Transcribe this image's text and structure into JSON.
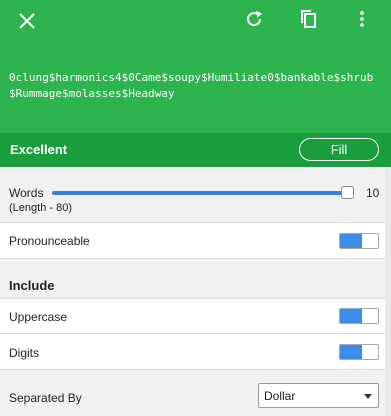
{
  "header": {
    "close_icon": "close-icon",
    "refresh_icon": "refresh-icon",
    "copy_icon": "copy-icon",
    "more_icon": "more-vertical-icon",
    "password": "0clung$harmonics4$0Came$soupy$Humiliate0$bankable$shrub$Rummage$molasses$Headway",
    "background_color": "#2eb44e"
  },
  "strength": {
    "label": "Excellent",
    "fill_button": "Fill",
    "background_color": "#1a9e3d"
  },
  "words": {
    "label": "Words",
    "sublabel": "(Length - 80)",
    "value": "10",
    "slider_level": 1.0
  },
  "pronounceable": {
    "label": "Pronounceable",
    "on": true
  },
  "include": {
    "heading": "Include",
    "uppercase": {
      "label": "Uppercase",
      "on": true
    },
    "digits": {
      "label": "Digits",
      "on": true
    }
  },
  "separator": {
    "label": "Separated By",
    "selected": "Dollar"
  },
  "accent_color": "#3b8ee8"
}
